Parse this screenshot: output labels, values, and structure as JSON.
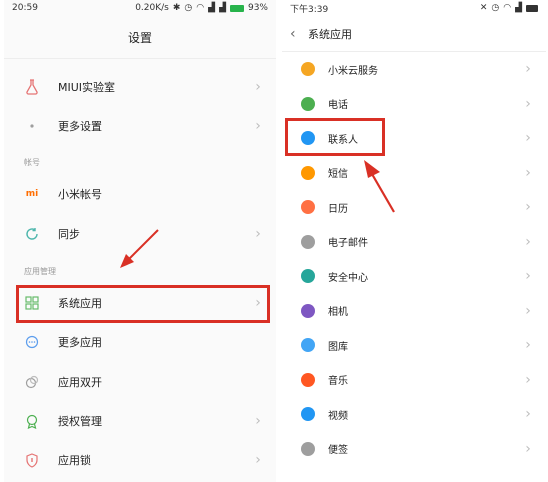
{
  "left": {
    "status": {
      "time": "20:59",
      "speed": "0.20K/s",
      "battery": "93%"
    },
    "title": "设置",
    "items": [
      {
        "label": "MIUI实验室",
        "icon": "flask-icon"
      },
      {
        "label": "更多设置",
        "icon": "dots-icon"
      },
      {
        "label": "小米帐号",
        "icon": "mi-logo-icon",
        "icon_text": "mi"
      },
      {
        "label": "同步",
        "icon": "sync-icon"
      },
      {
        "label": "系统应用",
        "icon": "grid-icon"
      },
      {
        "label": "更多应用",
        "icon": "more-circle-icon"
      },
      {
        "label": "应用双开",
        "icon": "dual-app-icon"
      },
      {
        "label": "授权管理",
        "icon": "badge-icon"
      },
      {
        "label": "应用锁",
        "icon": "shield-icon"
      }
    ],
    "sections": {
      "account": "帐号",
      "apps": "应用管理"
    }
  },
  "right": {
    "status": {
      "time": "下午3:39"
    },
    "title": "系统应用",
    "items": [
      {
        "label": "小米云服务",
        "icon": "cloud-icon",
        "color": "#f5a623"
      },
      {
        "label": "电话",
        "icon": "phone-icon",
        "color": "#4caf50"
      },
      {
        "label": "联系人",
        "icon": "contact-icon",
        "color": "#2196f3"
      },
      {
        "label": "短信",
        "icon": "message-icon",
        "color": "#ff9800"
      },
      {
        "label": "日历",
        "icon": "calendar-icon",
        "color": "#ff7043"
      },
      {
        "label": "电子邮件",
        "icon": "mail-icon",
        "color": "#9e9e9e"
      },
      {
        "label": "安全中心",
        "icon": "security-icon",
        "color": "#26a69a"
      },
      {
        "label": "相机",
        "icon": "camera-icon",
        "color": "#7e57c2"
      },
      {
        "label": "图库",
        "icon": "gallery-icon",
        "color": "#42a5f5"
      },
      {
        "label": "音乐",
        "icon": "music-icon",
        "color": "#ff5722"
      },
      {
        "label": "视频",
        "icon": "video-icon",
        "color": "#2196f3"
      },
      {
        "label": "便签",
        "icon": "note-icon",
        "color": "#9e9e9e"
      }
    ]
  },
  "accent": {
    "highlight": "#d93025"
  }
}
